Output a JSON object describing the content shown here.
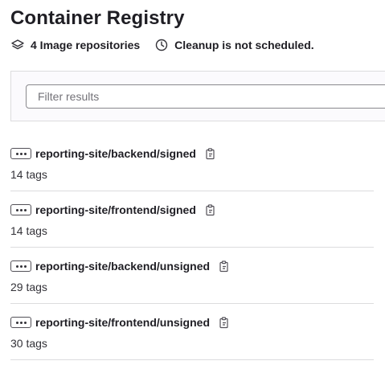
{
  "header": {
    "title": "Container Registry",
    "repo_count": "4 Image repositories",
    "cleanup_status": "Cleanup is not scheduled."
  },
  "filter": {
    "placeholder": "Filter results",
    "value": ""
  },
  "repositories": [
    {
      "name": "reporting-site/backend/signed",
      "tags": "14 tags"
    },
    {
      "name": "reporting-site/frontend/signed",
      "tags": "14 tags"
    },
    {
      "name": "reporting-site/backend/unsigned",
      "tags": "29 tags"
    },
    {
      "name": "reporting-site/frontend/unsigned",
      "tags": "30 tags"
    }
  ],
  "icons": {
    "repo_count": "layers-icon",
    "cleanup": "clock-icon",
    "row_toggle": "ellipsis-icon",
    "copy": "copy-to-clipboard-icon"
  }
}
